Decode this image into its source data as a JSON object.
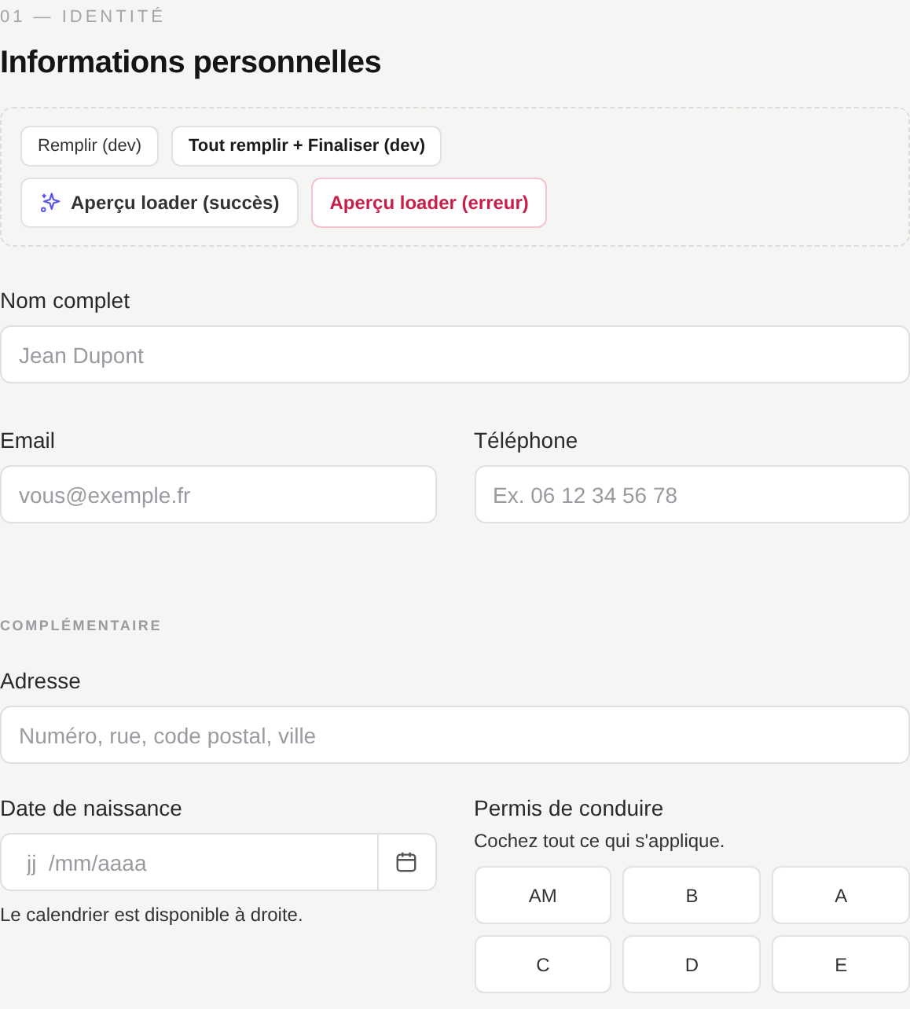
{
  "section": {
    "eyebrow": "01 — IDENTITÉ",
    "title": "Informations personnelles"
  },
  "dev_tools": [
    {
      "label": "Remplir (dev)",
      "kind": "plain"
    },
    {
      "label": "Tout remplir + Finaliser (dev)",
      "kind": "bold"
    },
    {
      "label": "Aperçu loader (succès)",
      "kind": "sparkle"
    },
    {
      "label": "Aperçu loader (erreur)",
      "kind": "danger"
    }
  ],
  "full_name": {
    "label": "Nom complet",
    "placeholder": "Jean Dupont"
  },
  "email": {
    "label": "Email",
    "placeholder": "vous@exemple.fr"
  },
  "phone": {
    "label": "Téléphone",
    "placeholder": "Ex. 06 12 34 56 78"
  },
  "complementary": {
    "heading": "COMPLÉMENTAIRE"
  },
  "address": {
    "label": "Adresse",
    "placeholder": "Numéro, rue, code postal, ville"
  },
  "birth_date": {
    "label": "Date de naissance",
    "placeholder": "jj  /mm/aaaa",
    "hint": "Le calendrier est disponible à droite."
  },
  "licence": {
    "label": "Permis de conduire",
    "hint": "Cochez tout ce qui s'applique.",
    "options": [
      {
        "label": "AM",
        "selected": false
      },
      {
        "label": "B",
        "selected": false
      },
      {
        "label": "A",
        "selected": false
      },
      {
        "label": "C",
        "selected": false
      },
      {
        "label": "D",
        "selected": false
      },
      {
        "label": "E",
        "selected": false
      }
    ]
  }
}
